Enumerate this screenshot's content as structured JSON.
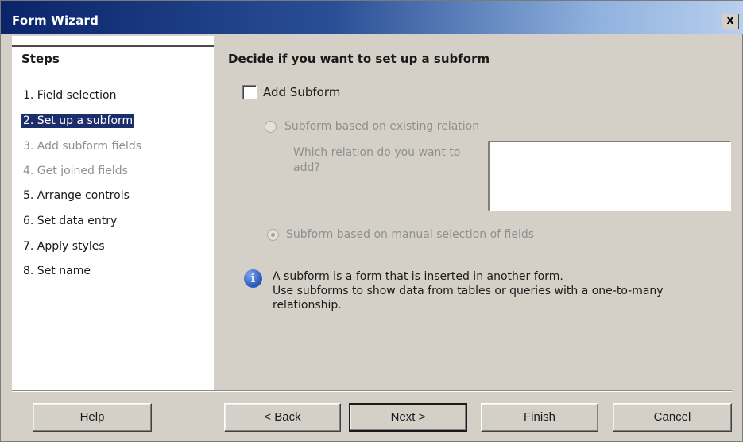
{
  "window": {
    "title": "Form Wizard",
    "close_label": "x"
  },
  "steps": {
    "title": "Steps",
    "items": [
      {
        "label": "1. Field selection",
        "state": "enabled"
      },
      {
        "label": "2. Set up a subform",
        "state": "active"
      },
      {
        "label": "3. Add subform fields",
        "state": "disabled"
      },
      {
        "label": "4. Get joined fields",
        "state": "disabled"
      },
      {
        "label": "5. Arrange controls",
        "state": "enabled"
      },
      {
        "label": "6. Set data entry",
        "state": "enabled"
      },
      {
        "label": "7. Apply styles",
        "state": "enabled"
      },
      {
        "label": "8. Set name",
        "state": "enabled"
      }
    ]
  },
  "main": {
    "heading": "Decide if you want to set up a subform",
    "add_subform": {
      "label": "Add Subform",
      "checked": false
    },
    "option_existing": {
      "label": "Subform based on existing relation",
      "selected": false,
      "enabled": false
    },
    "relation_question": "Which relation do you want to add?",
    "option_manual": {
      "label": "Subform based on manual selection of fields",
      "selected": true,
      "enabled": false
    },
    "info_line1": "A subform is a form that is inserted in another form.",
    "info_line2": "Use subforms to show data from tables or queries with a one-to-many relationship."
  },
  "buttons": {
    "help": "Help",
    "back": "< Back",
    "next": "Next >",
    "finish": "Finish",
    "cancel": "Cancel"
  }
}
